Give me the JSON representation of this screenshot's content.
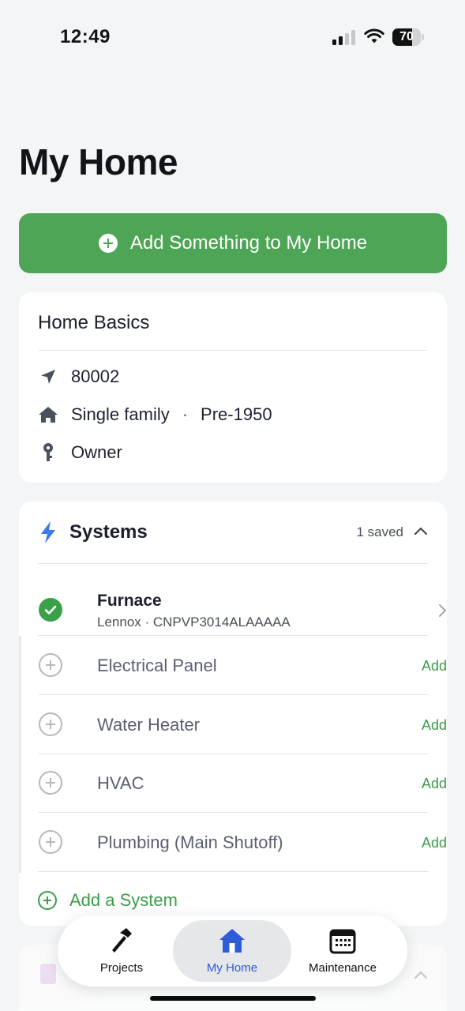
{
  "status_bar": {
    "time": "12:49",
    "battery": "70",
    "battery_level": 0.7
  },
  "page": {
    "title": "My Home"
  },
  "add_button": {
    "label": "Add Something to My Home",
    "icon": "plus-circle-icon"
  },
  "home_basics": {
    "title": "Home Basics",
    "zip": "80002",
    "home_type": "Single family",
    "separator": "·",
    "year_built": "Pre-1950",
    "ownership": "Owner"
  },
  "systems": {
    "title": "Systems",
    "saved_count": "1 saved",
    "saved_item": {
      "name": "Furnace",
      "detail": "Lennox · CNPVP3014ALAAAAA"
    },
    "items": [
      {
        "label": "Electrical Panel",
        "action": "Add"
      },
      {
        "label": "Water Heater",
        "action": "Add"
      },
      {
        "label": "HVAC",
        "action": "Add"
      },
      {
        "label": "Plumbing (Main Shutoff)",
        "action": "Add"
      }
    ],
    "add_label": "Add a System"
  },
  "tab_bar": {
    "tabs": [
      {
        "label": "Projects",
        "icon": "hammer-icon"
      },
      {
        "label": "My Home",
        "icon": "house-icon",
        "active": true
      },
      {
        "label": "Maintenance",
        "icon": "calendar-icon"
      }
    ]
  },
  "colors": {
    "accent_green": "#4ea556",
    "active_tab_blue": "#2e5bd6",
    "bolt_blue": "#3b7ae8"
  }
}
